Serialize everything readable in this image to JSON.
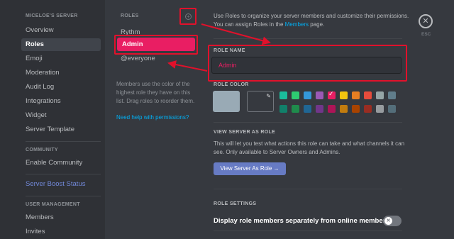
{
  "sidebar": {
    "server_header": "MICELOE'S SERVER",
    "server_items": [
      {
        "label": "Overview"
      },
      {
        "label": "Roles"
      },
      {
        "label": "Emoji"
      },
      {
        "label": "Moderation"
      },
      {
        "label": "Audit Log"
      },
      {
        "label": "Integrations"
      },
      {
        "label": "Widget"
      },
      {
        "label": "Server Template"
      }
    ],
    "community_header": "COMMUNITY",
    "community_items": [
      {
        "label": "Enable Community"
      }
    ],
    "boost_label": "Server Boost Status",
    "user_mgmt_header": "USER MANAGEMENT",
    "user_mgmt_items": [
      {
        "label": "Members"
      },
      {
        "label": "Invites"
      }
    ]
  },
  "roles": {
    "header": "ROLES",
    "add_icon": "plus-circle-icon",
    "items": [
      {
        "label": "Rythm"
      },
      {
        "label": "Admin"
      },
      {
        "label": "@everyone"
      }
    ],
    "description": "Members use the color of the highest role they have on this list. Drag roles to reorder them.",
    "help_link": "Need help with permissions?"
  },
  "editor": {
    "intro_before": "Use Roles to organize your server members and customize their permissions. You can assign Roles in the ",
    "intro_link": "Members",
    "intro_after": " page.",
    "role_name_label": "ROLE NAME",
    "role_name_value": "Admin",
    "role_color_label": "ROLE COLOR",
    "default_color": "#99aab5",
    "picker_icon": "eyedropper-icon",
    "swatches_row1": [
      "#1abc9c",
      "#2ecc71",
      "#3498db",
      "#9b59b6",
      "#e91e63",
      "#f1c40f",
      "#e67e22",
      "#e74c3c",
      "#95a5a6",
      "#607d8b"
    ],
    "swatches_row2": [
      "#11806a",
      "#1f8b4c",
      "#206694",
      "#71368a",
      "#ad1457",
      "#c27c0e",
      "#a84300",
      "#992d22",
      "#979c9f",
      "#546e7a"
    ],
    "selected_swatch": "#e91e63",
    "view_as_label": "VIEW SERVER AS ROLE",
    "view_as_desc": "This will let you test what actions this role can take and what channels it can see. Only available to Server Owners and Admins.",
    "view_as_button": "View Server As Role →",
    "role_settings_label": "ROLE SETTINGS",
    "display_separately": "Display role members separately from online members",
    "display_separately_on": false
  },
  "close": {
    "icon": "close-icon",
    "esc_label": "ESC"
  },
  "colors": {
    "accent": "#7289da",
    "highlight": "#e1112b",
    "role_pink": "#e91e63"
  }
}
